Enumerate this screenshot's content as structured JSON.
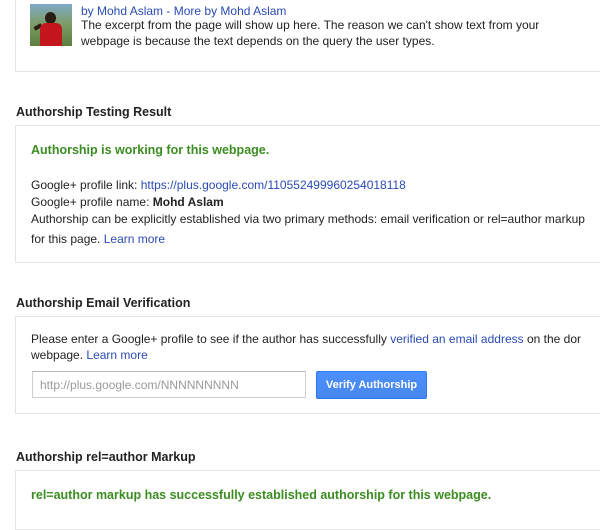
{
  "preview": {
    "author_link": "by Mohd Aslam",
    "separator": " - ",
    "more_link": "More by Mohd Aslam",
    "excerpt": "The excerpt from the page will show up here. The reason we can't show text from your webpage is because the text depends on the query the user types."
  },
  "testing_result": {
    "title": "Authorship Testing Result",
    "status": "Authorship is working for this webpage.",
    "profile_link_label": "Google+ profile link: ",
    "profile_link": "https://plus.google.com/110552499960254018118",
    "profile_name_label": "Google+ profile name: ",
    "profile_name": "Mohd Aslam",
    "methods_text": "Authorship can be explicitly established via two primary methods: email verification or rel=author markup",
    "methods_text_cont": "for this page. ",
    "learn_more": "Learn more"
  },
  "email_verification": {
    "title": "Authorship Email Verification",
    "intro_text": "Please enter a Google+ profile to see if the author has successfully ",
    "intro_link": "verified an email address",
    "intro_tail": " on the dor",
    "intro_line2": "webpage. ",
    "learn_more": "Learn more",
    "input_placeholder": "http://plus.google.com/NNNNNNNNN",
    "input_value": "",
    "button_label": "Verify Authorship"
  },
  "rel_author": {
    "title": "Authorship rel=author Markup",
    "status": "rel=author markup has successfully established authorship for this webpage."
  },
  "colors": {
    "link": "#2a4bb5",
    "success": "#3b8d21",
    "button": "#4d90fe"
  }
}
